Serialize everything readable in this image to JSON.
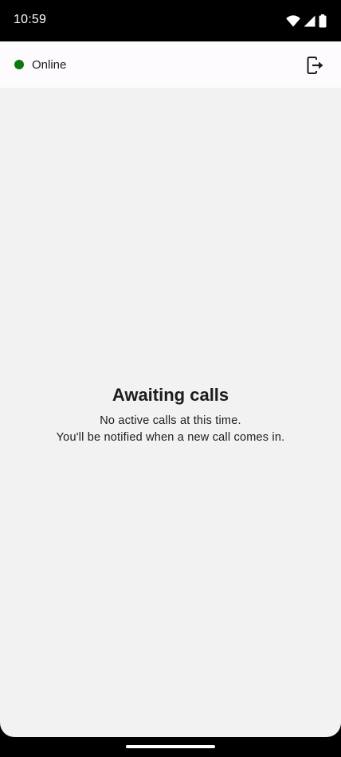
{
  "status_bar": {
    "time": "10:59",
    "icons": [
      "wifi-icon",
      "cellular-signal-icon",
      "battery-icon"
    ]
  },
  "app_bar": {
    "status_label": "Online",
    "status_color": "#0b7a0b",
    "logout_icon": "logout-icon"
  },
  "empty_state": {
    "title": "Awaiting calls",
    "line_1": "No active calls at this time.",
    "line_2": "You'll be notified when a new call comes in."
  },
  "colors": {
    "app_bar_background": "#fefbff",
    "content_background": "#f2f2f2",
    "system_bars": "#000000"
  }
}
